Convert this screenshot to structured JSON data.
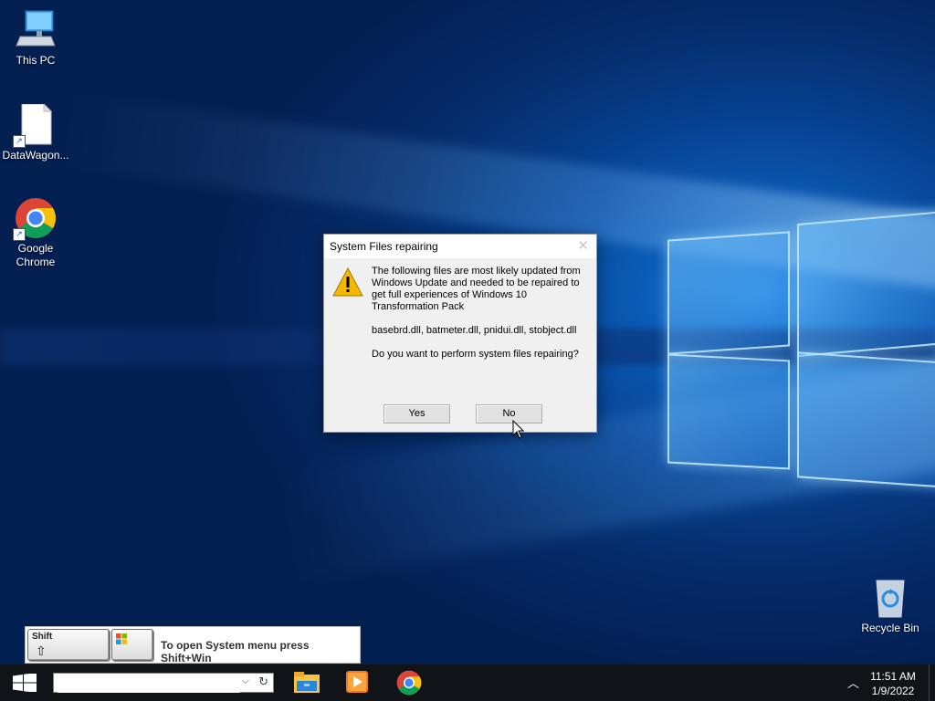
{
  "desktop": {
    "icons": [
      {
        "label": "This PC"
      },
      {
        "label": "DataWagon..."
      },
      {
        "label": "Google Chrome"
      },
      {
        "label": "Recycle Bin"
      }
    ]
  },
  "dialog": {
    "title": "System Files repairing",
    "close_glyph": "✕",
    "message_intro": "The following files are most likely updated from Windows Update and needed to be repaired to get full experiences of Windows 10 Transformation Pack",
    "files": "basebrd.dll, batmeter.dll, pnidui.dll, stobject.dll",
    "question": "Do you want to perform system files repairing?",
    "yes_label": "Yes",
    "no_label": "No",
    "icon": "warning-icon"
  },
  "keytip": {
    "shift_label": "Shift",
    "text": "To open System menu press Shift+Win"
  },
  "taskbar": {
    "search_value": "",
    "pinned": [
      "file-explorer-icon",
      "media-player-icon",
      "chrome-icon"
    ],
    "time": "11:51 AM",
    "date": "1/9/2022"
  },
  "colors": {
    "desktop_blue": "#0a5cb8",
    "taskbar": "#101418",
    "dialog_bg": "#f0f0f0",
    "warning": "#f5b800"
  }
}
